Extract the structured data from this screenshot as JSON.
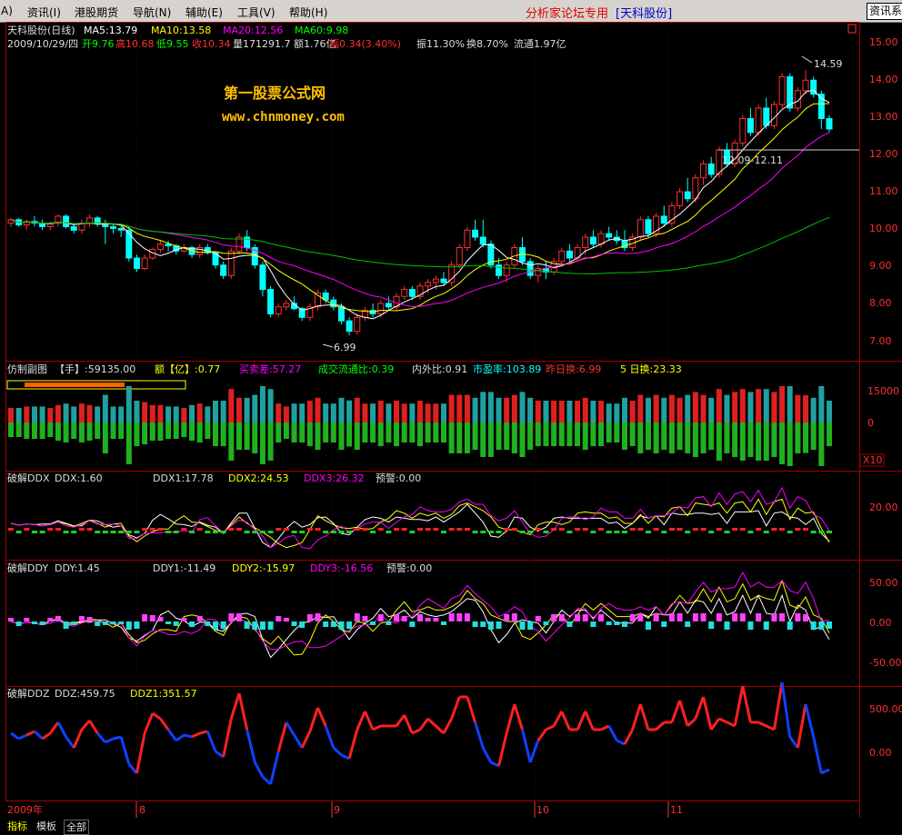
{
  "menu": {
    "left_fragment": "A)",
    "items": [
      "资讯(I)",
      "港股期货",
      "导航(N)",
      "辅助(E)",
      "工具(V)",
      "帮助(H)"
    ],
    "brand": "分析家论坛专用",
    "brand_stock": "[天科股份]",
    "right_button": "资讯系"
  },
  "colors": {
    "up": "#ff3030",
    "down": "#00ffff",
    "ma5": "#ffffff",
    "ma10": "#ffff00",
    "ma20": "#ff00ff",
    "ma60": "#00c000",
    "grid": "#a00000",
    "watermark": "#ffc000"
  },
  "watermark": {
    "line1": "第一股票公式网",
    "line2": "www.chnmoney.com"
  },
  "main": {
    "header1": {
      "name": "天科股份(日线)",
      "ma5": "MA5:13.79",
      "ma10": "MA10:13.58",
      "ma20": "MA20:12.56",
      "ma60": "MA60:9.98"
    },
    "header2": {
      "date": "2009/10/29/四",
      "open": "开9.76",
      "high": "高10.68",
      "low": "低9.55",
      "close": "收10.34",
      "vol": "量171291.7",
      "amt": "额1.76亿",
      "change": "幅0.34(3.40%)",
      "amp": "振11.30%",
      "turnover": "换8.70%",
      "float": "流通1.97亿"
    },
    "annotations": {
      "high": "14.59",
      "low": "6.99",
      "range_label": "12.09-12.11"
    },
    "y_ticks": [
      "15.00",
      "14.00",
      "13.00",
      "12.00",
      "11.00",
      "10.00",
      "9.00",
      "8.00",
      "7.00"
    ]
  },
  "vol_panel": {
    "header": [
      "仿制副图",
      "【手】:59135.00",
      "额【亿】:0.77",
      "买卖差:57.27",
      "成交流通比:0.39",
      "内外比:0.91",
      "市盈率:103.89",
      "昨日换:6.99",
      "5 日换:23.33"
    ],
    "y_ticks": [
      "15000",
      "0"
    ],
    "scale": "X10"
  },
  "ddx_panel": {
    "header": [
      "破解DDX",
      "DDX:1.60",
      "DDX1:17.78",
      "DDX2:24.53",
      "DDX3:26.32",
      "预警:0.00"
    ],
    "y_ticks": [
      "20.00"
    ]
  },
  "ddy_panel": {
    "header": [
      "破解DDY",
      "DDY:1.45",
      "DDY1:-11.49",
      "DDY2:-15.97",
      "DDY3:-16.56",
      "预警:0.00"
    ],
    "y_ticks": [
      "50.00",
      "0.00",
      "-50.00"
    ]
  },
  "ddz_panel": {
    "header": [
      "破解DDZ",
      "DDZ:459.75",
      "DDZ1:351.57"
    ],
    "y_ticks": [
      "500.00",
      "0.00"
    ]
  },
  "time_axis": [
    "2009年",
    "8",
    "9",
    "10",
    "11"
  ],
  "bottom_tabs": [
    "指标",
    "模板",
    "全部"
  ],
  "chart_data": {
    "type": "candlestick",
    "y_range": [
      6.7,
      15.4
    ],
    "candles": [
      [
        10.2,
        10.35,
        10.1,
        10.3
      ],
      [
        10.3,
        10.35,
        10.1,
        10.15
      ],
      [
        10.15,
        10.3,
        10.0,
        10.25
      ],
      [
        10.25,
        10.4,
        10.1,
        10.2
      ],
      [
        10.2,
        10.3,
        10.0,
        10.1
      ],
      [
        10.1,
        10.25,
        10.0,
        10.2
      ],
      [
        10.2,
        10.45,
        10.1,
        10.4
      ],
      [
        10.4,
        10.45,
        10.05,
        10.1
      ],
      [
        10.1,
        10.2,
        9.9,
        10.0
      ],
      [
        10.0,
        10.3,
        9.9,
        10.2
      ],
      [
        10.2,
        10.45,
        10.1,
        10.35
      ],
      [
        10.35,
        10.4,
        10.1,
        10.2
      ],
      [
        10.2,
        10.3,
        9.6,
        10.1
      ],
      [
        10.1,
        10.2,
        9.9,
        10.05
      ],
      [
        10.05,
        10.1,
        9.8,
        10.0
      ],
      [
        10.0,
        10.1,
        9.1,
        9.2
      ],
      [
        9.2,
        9.3,
        8.8,
        8.9
      ],
      [
        8.9,
        9.3,
        8.85,
        9.2
      ],
      [
        9.2,
        9.5,
        9.15,
        9.45
      ],
      [
        9.45,
        9.7,
        9.35,
        9.6
      ],
      [
        9.6,
        9.7,
        9.4,
        9.55
      ],
      [
        9.55,
        9.6,
        9.3,
        9.4
      ],
      [
        9.4,
        9.6,
        9.35,
        9.5
      ],
      [
        9.5,
        9.55,
        9.2,
        9.3
      ],
      [
        9.3,
        9.6,
        9.2,
        9.5
      ],
      [
        9.5,
        9.6,
        9.3,
        9.35
      ],
      [
        9.35,
        9.4,
        8.9,
        9.0
      ],
      [
        9.0,
        9.1,
        8.6,
        8.7
      ],
      [
        8.7,
        9.5,
        8.6,
        9.4
      ],
      [
        9.4,
        9.9,
        9.3,
        9.8
      ],
      [
        9.8,
        10.0,
        9.4,
        9.5
      ],
      [
        9.5,
        9.6,
        8.9,
        9.0
      ],
      [
        9.0,
        9.1,
        8.1,
        8.3
      ],
      [
        8.3,
        8.4,
        7.5,
        7.6
      ],
      [
        7.6,
        7.9,
        7.5,
        7.8
      ],
      [
        7.8,
        8.0,
        7.7,
        7.9
      ],
      [
        7.9,
        8.1,
        7.7,
        7.75
      ],
      [
        7.75,
        7.8,
        7.4,
        7.5
      ],
      [
        7.5,
        7.9,
        7.4,
        7.8
      ],
      [
        7.8,
        8.3,
        7.7,
        8.2
      ],
      [
        8.2,
        8.3,
        7.9,
        8.0
      ],
      [
        8.0,
        8.1,
        7.7,
        7.8
      ],
      [
        7.8,
        7.9,
        7.3,
        7.4
      ],
      [
        7.4,
        7.5,
        6.99,
        7.1
      ],
      [
        7.1,
        7.6,
        7.0,
        7.5
      ],
      [
        7.5,
        7.8,
        7.4,
        7.7
      ],
      [
        7.7,
        7.9,
        7.5,
        7.6
      ],
      [
        7.6,
        8.0,
        7.5,
        7.9
      ],
      [
        7.9,
        8.1,
        7.7,
        7.8
      ],
      [
        7.8,
        8.2,
        7.7,
        8.1
      ],
      [
        8.1,
        8.4,
        8.0,
        8.3
      ],
      [
        8.3,
        8.4,
        8.0,
        8.1
      ],
      [
        8.1,
        8.5,
        8.0,
        8.4
      ],
      [
        8.4,
        8.6,
        8.2,
        8.5
      ],
      [
        8.5,
        8.7,
        8.3,
        8.6
      ],
      [
        8.6,
        8.8,
        8.4,
        8.5
      ],
      [
        8.5,
        9.1,
        8.4,
        9.0
      ],
      [
        9.0,
        9.6,
        8.9,
        9.5
      ],
      [
        9.5,
        10.1,
        9.4,
        10.0
      ],
      [
        10.0,
        10.3,
        9.7,
        9.8
      ],
      [
        9.8,
        10.3,
        9.5,
        9.6
      ],
      [
        9.6,
        9.7,
        8.9,
        9.0
      ],
      [
        9.0,
        9.2,
        8.6,
        8.7
      ],
      [
        8.7,
        9.1,
        8.5,
        9.0
      ],
      [
        9.0,
        9.6,
        8.9,
        9.5
      ],
      [
        9.5,
        9.8,
        9.0,
        9.1
      ],
      [
        9.1,
        9.2,
        8.6,
        8.7
      ],
      [
        8.7,
        9.0,
        8.5,
        8.9
      ],
      [
        8.9,
        9.1,
        8.6,
        8.8
      ],
      [
        8.8,
        9.2,
        8.7,
        9.1
      ],
      [
        9.1,
        9.5,
        9.0,
        9.4
      ],
      [
        9.4,
        9.6,
        9.1,
        9.2
      ],
      [
        9.2,
        9.6,
        9.1,
        9.5
      ],
      [
        9.5,
        9.9,
        9.3,
        9.8
      ],
      [
        9.8,
        10.0,
        9.5,
        9.6
      ],
      [
        9.6,
        10.0,
        9.5,
        9.9
      ],
      [
        9.9,
        10.1,
        9.7,
        9.8
      ],
      [
        9.8,
        10.0,
        9.6,
        9.7
      ],
      [
        9.7,
        10.0,
        9.4,
        9.5
      ],
      [
        9.5,
        9.9,
        9.4,
        9.8
      ],
      [
        9.8,
        10.4,
        9.7,
        10.3
      ],
      [
        10.3,
        10.4,
        9.8,
        9.9
      ],
      [
        9.9,
        10.5,
        9.8,
        10.4
      ],
      [
        10.4,
        10.7,
        10.1,
        10.2
      ],
      [
        10.2,
        10.8,
        10.1,
        10.7
      ],
      [
        10.7,
        11.2,
        10.6,
        11.1
      ],
      [
        11.1,
        11.5,
        10.8,
        10.9
      ],
      [
        10.9,
        11.6,
        10.8,
        11.5
      ],
      [
        11.5,
        12.0,
        11.3,
        11.9
      ],
      [
        11.9,
        12.1,
        11.5,
        11.6
      ],
      [
        11.6,
        12.4,
        11.5,
        12.3
      ],
      [
        12.3,
        12.5,
        11.8,
        11.9
      ],
      [
        11.9,
        12.6,
        11.8,
        12.5
      ],
      [
        12.5,
        13.3,
        12.4,
        13.2
      ],
      [
        13.2,
        13.5,
        12.7,
        12.8
      ],
      [
        12.8,
        13.6,
        12.7,
        13.5
      ],
      [
        13.5,
        13.8,
        12.9,
        13.0
      ],
      [
        13.0,
        13.7,
        12.9,
        13.6
      ],
      [
        13.6,
        14.5,
        13.5,
        14.4
      ],
      [
        14.4,
        14.5,
        13.4,
        13.5
      ],
      [
        13.5,
        14.1,
        13.4,
        14.0
      ],
      [
        14.0,
        14.59,
        13.9,
        14.3
      ],
      [
        14.3,
        14.4,
        13.8,
        13.9
      ],
      [
        13.9,
        14.0,
        12.9,
        13.2
      ],
      [
        13.2,
        13.3,
        12.8,
        12.9
      ]
    ]
  }
}
